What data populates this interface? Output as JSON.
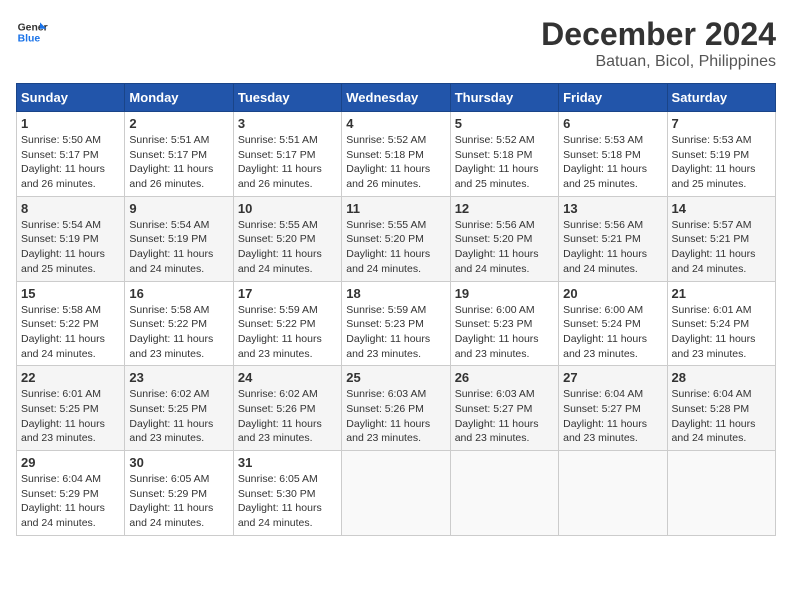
{
  "logo": {
    "line1": "General",
    "line2": "Blue"
  },
  "title": {
    "month_year": "December 2024",
    "location": "Batuan, Bicol, Philippines"
  },
  "headers": [
    "Sunday",
    "Monday",
    "Tuesday",
    "Wednesday",
    "Thursday",
    "Friday",
    "Saturday"
  ],
  "weeks": [
    [
      {
        "day": "1",
        "info": "Sunrise: 5:50 AM\nSunset: 5:17 PM\nDaylight: 11 hours\nand 26 minutes."
      },
      {
        "day": "2",
        "info": "Sunrise: 5:51 AM\nSunset: 5:17 PM\nDaylight: 11 hours\nand 26 minutes."
      },
      {
        "day": "3",
        "info": "Sunrise: 5:51 AM\nSunset: 5:17 PM\nDaylight: 11 hours\nand 26 minutes."
      },
      {
        "day": "4",
        "info": "Sunrise: 5:52 AM\nSunset: 5:18 PM\nDaylight: 11 hours\nand 26 minutes."
      },
      {
        "day": "5",
        "info": "Sunrise: 5:52 AM\nSunset: 5:18 PM\nDaylight: 11 hours\nand 25 minutes."
      },
      {
        "day": "6",
        "info": "Sunrise: 5:53 AM\nSunset: 5:18 PM\nDaylight: 11 hours\nand 25 minutes."
      },
      {
        "day": "7",
        "info": "Sunrise: 5:53 AM\nSunset: 5:19 PM\nDaylight: 11 hours\nand 25 minutes."
      }
    ],
    [
      {
        "day": "8",
        "info": "Sunrise: 5:54 AM\nSunset: 5:19 PM\nDaylight: 11 hours\nand 25 minutes."
      },
      {
        "day": "9",
        "info": "Sunrise: 5:54 AM\nSunset: 5:19 PM\nDaylight: 11 hours\nand 24 minutes."
      },
      {
        "day": "10",
        "info": "Sunrise: 5:55 AM\nSunset: 5:20 PM\nDaylight: 11 hours\nand 24 minutes."
      },
      {
        "day": "11",
        "info": "Sunrise: 5:55 AM\nSunset: 5:20 PM\nDaylight: 11 hours\nand 24 minutes."
      },
      {
        "day": "12",
        "info": "Sunrise: 5:56 AM\nSunset: 5:20 PM\nDaylight: 11 hours\nand 24 minutes."
      },
      {
        "day": "13",
        "info": "Sunrise: 5:56 AM\nSunset: 5:21 PM\nDaylight: 11 hours\nand 24 minutes."
      },
      {
        "day": "14",
        "info": "Sunrise: 5:57 AM\nSunset: 5:21 PM\nDaylight: 11 hours\nand 24 minutes."
      }
    ],
    [
      {
        "day": "15",
        "info": "Sunrise: 5:58 AM\nSunset: 5:22 PM\nDaylight: 11 hours\nand 24 minutes."
      },
      {
        "day": "16",
        "info": "Sunrise: 5:58 AM\nSunset: 5:22 PM\nDaylight: 11 hours\nand 23 minutes."
      },
      {
        "day": "17",
        "info": "Sunrise: 5:59 AM\nSunset: 5:22 PM\nDaylight: 11 hours\nand 23 minutes."
      },
      {
        "day": "18",
        "info": "Sunrise: 5:59 AM\nSunset: 5:23 PM\nDaylight: 11 hours\nand 23 minutes."
      },
      {
        "day": "19",
        "info": "Sunrise: 6:00 AM\nSunset: 5:23 PM\nDaylight: 11 hours\nand 23 minutes."
      },
      {
        "day": "20",
        "info": "Sunrise: 6:00 AM\nSunset: 5:24 PM\nDaylight: 11 hours\nand 23 minutes."
      },
      {
        "day": "21",
        "info": "Sunrise: 6:01 AM\nSunset: 5:24 PM\nDaylight: 11 hours\nand 23 minutes."
      }
    ],
    [
      {
        "day": "22",
        "info": "Sunrise: 6:01 AM\nSunset: 5:25 PM\nDaylight: 11 hours\nand 23 minutes."
      },
      {
        "day": "23",
        "info": "Sunrise: 6:02 AM\nSunset: 5:25 PM\nDaylight: 11 hours\nand 23 minutes."
      },
      {
        "day": "24",
        "info": "Sunrise: 6:02 AM\nSunset: 5:26 PM\nDaylight: 11 hours\nand 23 minutes."
      },
      {
        "day": "25",
        "info": "Sunrise: 6:03 AM\nSunset: 5:26 PM\nDaylight: 11 hours\nand 23 minutes."
      },
      {
        "day": "26",
        "info": "Sunrise: 6:03 AM\nSunset: 5:27 PM\nDaylight: 11 hours\nand 23 minutes."
      },
      {
        "day": "27",
        "info": "Sunrise: 6:04 AM\nSunset: 5:27 PM\nDaylight: 11 hours\nand 23 minutes."
      },
      {
        "day": "28",
        "info": "Sunrise: 6:04 AM\nSunset: 5:28 PM\nDaylight: 11 hours\nand 24 minutes."
      }
    ],
    [
      {
        "day": "29",
        "info": "Sunrise: 6:04 AM\nSunset: 5:29 PM\nDaylight: 11 hours\nand 24 minutes."
      },
      {
        "day": "30",
        "info": "Sunrise: 6:05 AM\nSunset: 5:29 PM\nDaylight: 11 hours\nand 24 minutes."
      },
      {
        "day": "31",
        "info": "Sunrise: 6:05 AM\nSunset: 5:30 PM\nDaylight: 11 hours\nand 24 minutes."
      },
      {
        "day": "",
        "info": ""
      },
      {
        "day": "",
        "info": ""
      },
      {
        "day": "",
        "info": ""
      },
      {
        "day": "",
        "info": ""
      }
    ]
  ]
}
